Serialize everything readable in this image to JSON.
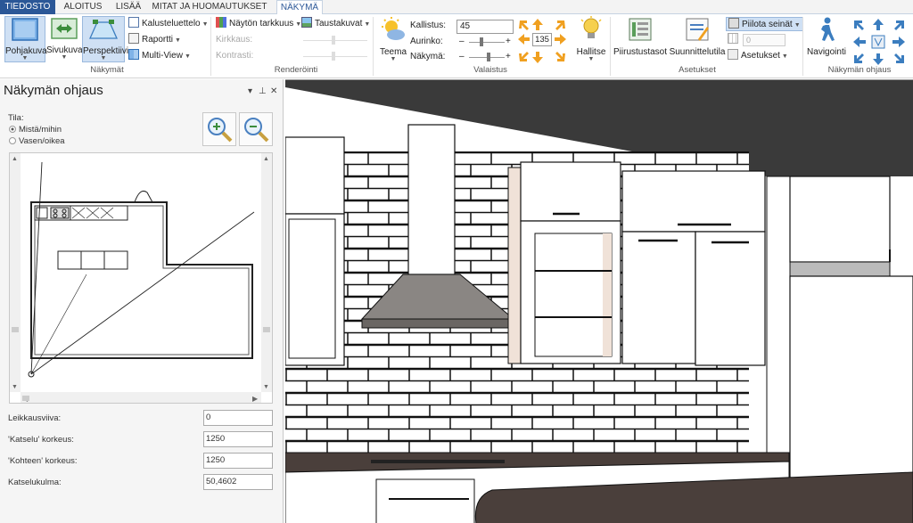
{
  "tabs": [
    "TIEDOSTO",
    "ALOITUS",
    "LISÄÄ",
    "MITAT JA HUOMAUTUKSET",
    "NÄKYMÄ"
  ],
  "ribbon": {
    "groups": {
      "nakymat": "Näkymät",
      "renderointi": "Renderöinti",
      "valaistus": "Valaistus",
      "asetukset": "Asetukset",
      "nakyman_ohjaus": "Näkymän ohjaus"
    },
    "views": {
      "pohjakuva": "Pohjakuva",
      "sivukuva": "Sivukuva",
      "perspektiivi": "Perspektiivi",
      "kalusteluettelo": "Kalusteluettelo",
      "raportti": "Raportti",
      "multiview": "Multi-View"
    },
    "render": {
      "quality": "Näytön tarkkuus",
      "backgrounds": "Taustakuvat",
      "brightness": "Kirkkaus:",
      "contrast": "Kontrasti:"
    },
    "lighting": {
      "theme": "Teema",
      "tilt_label": "Kallistus:",
      "tilt_value": "45",
      "sun_label": "Aurinko:",
      "view_label": "Näkymä:",
      "angle_value": "135",
      "manage": "Hallitse"
    },
    "settings": {
      "drawing_levels": "Piirustustasot",
      "design_space": "Suunnittelutila",
      "hide_walls": "Piilota seinät",
      "hide_value": "0",
      "settings": "Asetukset"
    },
    "navigation": {
      "navigate": "Navigointi"
    }
  },
  "panel": {
    "title": "Näkymän ohjaus",
    "mode_label": "Tila:",
    "mode_options": [
      "Mistä/mihin",
      "Vasen/oikea"
    ],
    "mode_selected": 0,
    "fields": [
      {
        "label": "Leikkausviiva:",
        "value": "0"
      },
      {
        "label": "'Katselu' korkeus:",
        "value": "1250"
      },
      {
        "label": "'Kohteen' korkeus:",
        "value": "1250"
      },
      {
        "label": "Katselukulma:",
        "value": "50,4602"
      }
    ]
  },
  "icons": {
    "pin": "pin-icon",
    "close": "close-icon",
    "dropdown": "chevron-down-icon",
    "zoom_in": "zoom-in-icon",
    "zoom_out": "zoom-out-icon"
  },
  "colors": {
    "file_tab": "#2b5797",
    "active_tab_text": "#2b5797",
    "pressed_button": "#cfe0f4",
    "countertop": "#4a3f3b",
    "ceiling": "#3a3a3a"
  }
}
